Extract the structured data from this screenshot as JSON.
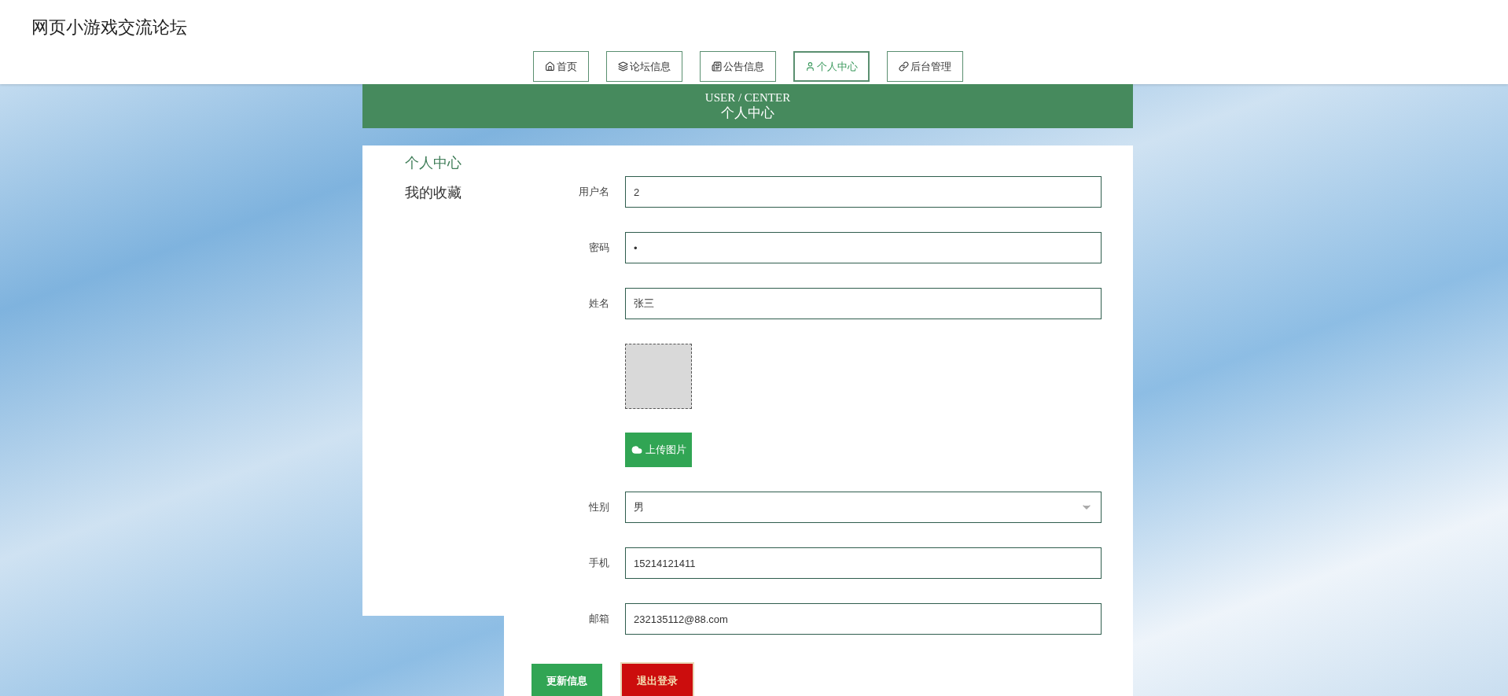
{
  "site_title": "网页小游戏交流论坛",
  "nav": [
    {
      "label": "首页",
      "selected": false
    },
    {
      "label": "论坛信息",
      "selected": false
    },
    {
      "label": "公告信息",
      "selected": false
    },
    {
      "label": "个人中心",
      "selected": true
    },
    {
      "label": "后台管理",
      "selected": false
    }
  ],
  "banner": {
    "subtitle": "USER / CENTER",
    "title": "个人中心"
  },
  "sidebar": [
    {
      "label": "个人中心",
      "selected": true
    },
    {
      "label": "我的收藏",
      "selected": false
    }
  ],
  "form": {
    "fields": [
      {
        "kind": "text",
        "label": "用户名",
        "value": "2"
      },
      {
        "kind": "text",
        "label": "密码",
        "value": "•"
      },
      {
        "kind": "text",
        "label": "姓名",
        "value": "张三"
      },
      {
        "kind": "image",
        "button": "上传图片"
      },
      {
        "kind": "select",
        "label": "性别",
        "value": "男"
      },
      {
        "kind": "text",
        "label": "手机",
        "value": "15214121411"
      },
      {
        "kind": "text",
        "label": "邮箱",
        "value": "232135112@88.com"
      }
    ],
    "buttons": [
      {
        "kind": "primary",
        "label": "更新信息"
      },
      {
        "kind": "danger",
        "label": "退出登录"
      }
    ]
  }
}
